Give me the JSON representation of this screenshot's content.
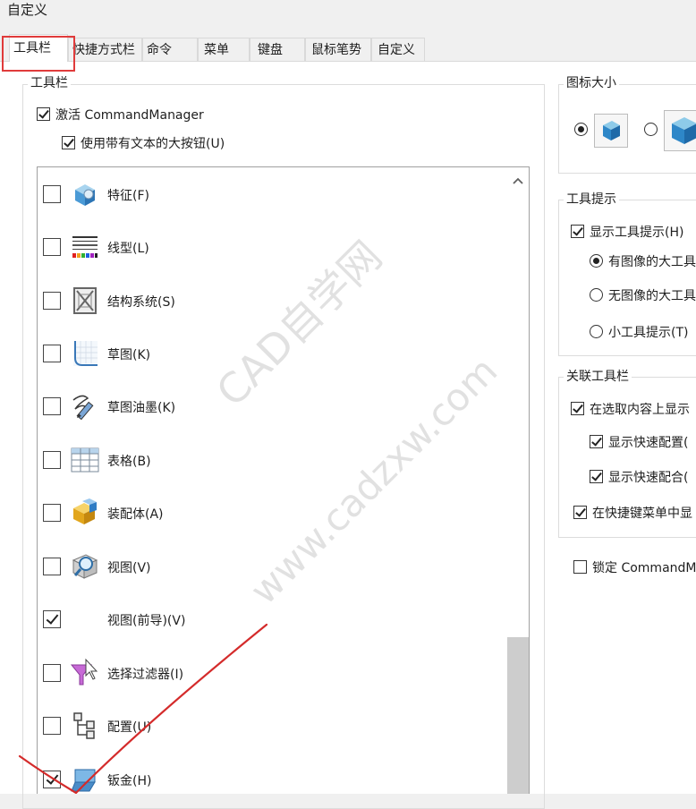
{
  "window": {
    "title": "自定义"
  },
  "tabs": [
    {
      "label": "工具栏"
    },
    {
      "label": "快捷方式栏"
    },
    {
      "label": "命令"
    },
    {
      "label": "菜单"
    },
    {
      "label": "键盘"
    },
    {
      "label": "鼠标笔势"
    },
    {
      "label": "自定义"
    }
  ],
  "toolbars_group": {
    "title": "工具栏",
    "activate_cm": "激活 CommandManager",
    "large_buttons": "使用带有文本的大按钮(U)",
    "items": [
      {
        "label": "特征(F)",
        "checked": false,
        "icon": "features-icon"
      },
      {
        "label": "线型(L)",
        "checked": false,
        "icon": "line-format-icon"
      },
      {
        "label": "结构系统(S)",
        "checked": false,
        "icon": "structure-system-icon"
      },
      {
        "label": "草图(K)",
        "checked": false,
        "icon": "sketch-icon"
      },
      {
        "label": "草图油墨(K)",
        "checked": false,
        "icon": "sketch-ink-icon"
      },
      {
        "label": "表格(B)",
        "checked": false,
        "icon": "table-icon"
      },
      {
        "label": "装配体(A)",
        "checked": false,
        "icon": "assembly-icon"
      },
      {
        "label": "视图(V)",
        "checked": false,
        "icon": "view-icon"
      },
      {
        "label": "视图(前导)(V)",
        "checked": true,
        "icon": ""
      },
      {
        "label": "选择过滤器(I)",
        "checked": false,
        "icon": "selection-filter-icon"
      },
      {
        "label": "配置(U)",
        "checked": false,
        "icon": "configuration-icon"
      },
      {
        "label": "钣金(H)",
        "checked": true,
        "icon": "sheet-metal-icon"
      }
    ]
  },
  "icon_size": {
    "title": "图标大小"
  },
  "tooltips": {
    "title": "工具提示",
    "show": "显示工具提示(H)",
    "opt1": "有图像的大工具",
    "opt2": "无图像的大工具",
    "opt3": "小工具提示(T)"
  },
  "context": {
    "title": "关联工具栏",
    "show_on_select": "在选取内容上显示",
    "quick_config": "显示快速配置(",
    "quick_mate": "显示快速配合(",
    "in_shortcut": "在快捷键菜单中显"
  },
  "lock_cm": "锁定 CommandM",
  "watermark": {
    "line1": "CAD自学网",
    "line2": "www.cadzxw.com"
  },
  "colors": {
    "accent_red": "#e03b3b",
    "annotation_red": "#d42b2b"
  }
}
